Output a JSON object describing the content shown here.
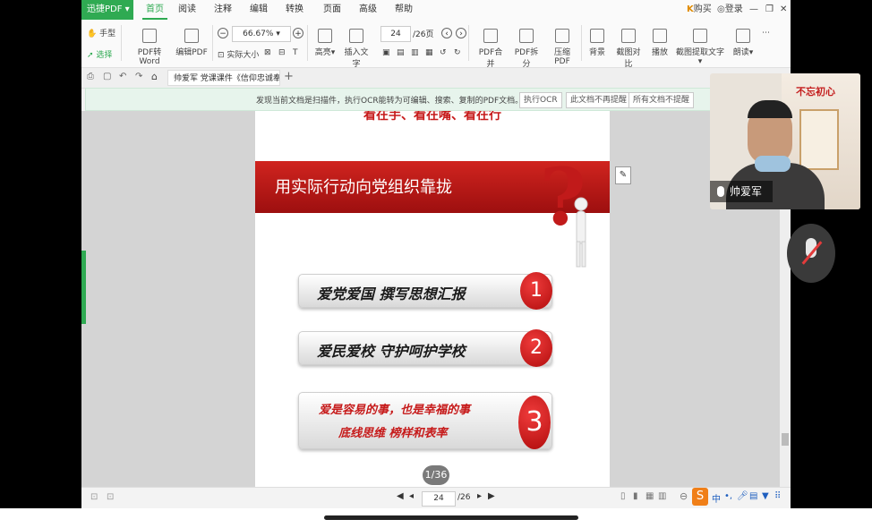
{
  "titlebar": {
    "app_name": "迅捷PDF",
    "menus": [
      "首页",
      "阅读",
      "注释",
      "编辑",
      "转换",
      "页面",
      "高级",
      "帮助"
    ],
    "active_menu": "首页",
    "buy": "购买",
    "login": "登录"
  },
  "toolbar": {
    "hand": "手型",
    "select": "选择",
    "pdf_to_word": "PDF转Word",
    "edit_pdf": "编辑PDF",
    "zoom": "66.67%",
    "actual_size": "实际大小",
    "highlight": "高亮",
    "insert_text": "插入文字",
    "page_current": "24",
    "page_total": "/26页",
    "merge": "PDF合并",
    "split": "PDF拆分",
    "compress": "压缩PDF",
    "background": "背景",
    "compare": "截图对比",
    "play": "播放",
    "extract_text": "截图提取文字",
    "read_aloud": "朗读"
  },
  "tab": {
    "title": "帅爱军 党课课件《信仰忠诚奉..."
  },
  "ocr_bar": {
    "message": "发现当前文档是扫描件，执行OCR能转为可编辑、搜索、复制的PDF文档。",
    "run_ocr": "执行OCR",
    "dont_remind_doc": "此文档不再提醒",
    "dont_remind_all": "所有文档不提醒"
  },
  "slide": {
    "top_text": "看在手、看在嘴、看在行",
    "banner": "用实际行动向党组织靠拢",
    "items": [
      {
        "num": "1",
        "line1": "爱党爱国 撰写思想汇报",
        "line2": ""
      },
      {
        "num": "2",
        "line1": "爱民爱校 守护呵护学校",
        "line2": ""
      },
      {
        "num": "3",
        "line1": "爱是容易的事，也是幸福的事",
        "line2": "底线思维 榜样和表率"
      }
    ],
    "page_chip": "1/36"
  },
  "statusbar": {
    "page_current": "24",
    "page_total": "/26"
  },
  "video": {
    "participant_name": "帅爱军",
    "wall_banner": "不忘初心"
  }
}
